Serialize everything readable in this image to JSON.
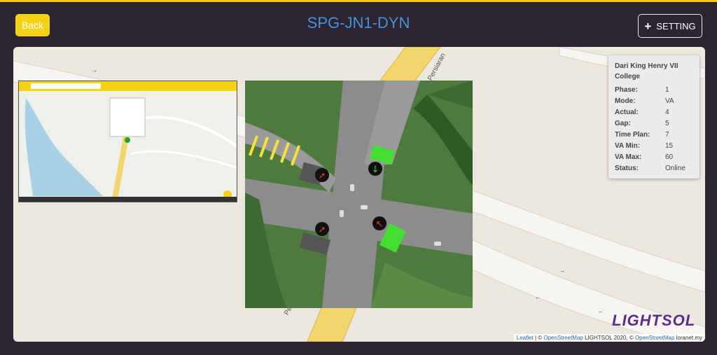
{
  "header": {
    "back_label": "Back",
    "title": "SPG-JN1-DYN",
    "setting_label": "SETTING"
  },
  "map": {
    "road_labels": [
      "Persiaran",
      "Persiaran"
    ]
  },
  "info": {
    "heading": "Dari King Henry VII College",
    "rows": [
      {
        "label": "Phase:",
        "value": "1"
      },
      {
        "label": "Mode:",
        "value": "VA"
      },
      {
        "label": "Actual:",
        "value": "4"
      },
      {
        "label": "Gap:",
        "value": "5"
      },
      {
        "label": "Time Plan:",
        "value": "7"
      },
      {
        "label": "VA Min:",
        "value": "15"
      },
      {
        "label": "VA Max:",
        "value": "60"
      },
      {
        "label": "Status:",
        "value": "Online"
      }
    ]
  },
  "logo": "LIGHTSOL",
  "attribution": {
    "leaflet": "Leaflet",
    "sep1": " | © ",
    "osm1": "OpenStreetMap",
    "mid": " LIGHTSOL 2020, © ",
    "osm2": "OpenStreetMap",
    "end": " loranet.my"
  },
  "colors": {
    "accent": "#f5d218",
    "title": "#4a90d9",
    "logo": "#5a2d8c",
    "signal_red": "#e03a2e",
    "signal_green": "#44dd33"
  }
}
